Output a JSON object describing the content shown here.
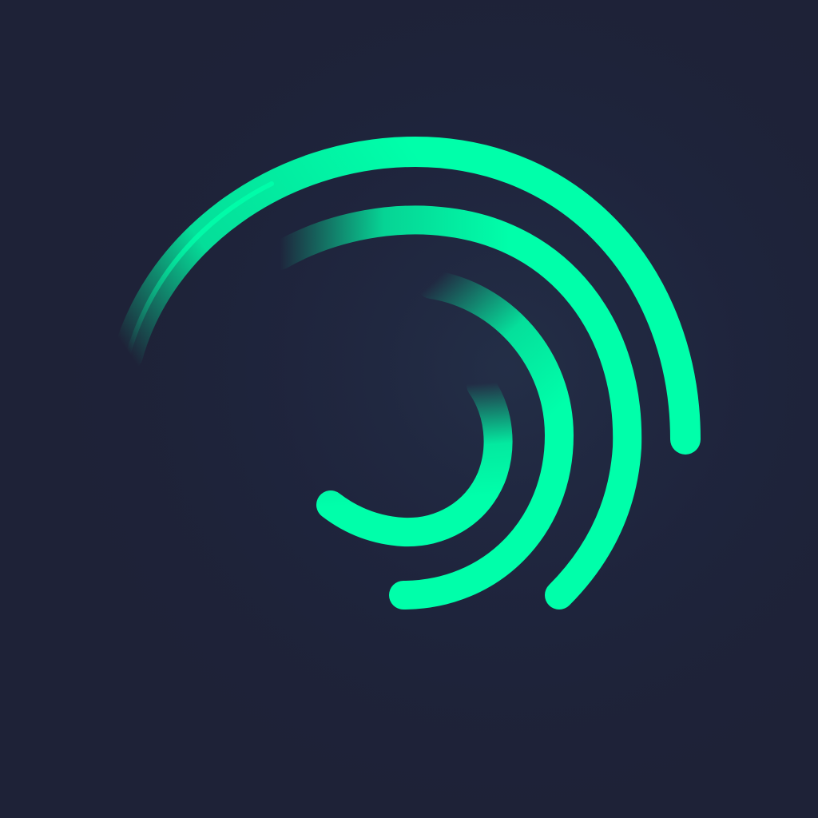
{
  "icon": {
    "name": "spiral-arcs-logo-icon",
    "colors": {
      "background": "#1e2237",
      "background_glow": "#22304a",
      "accent": "#00ffaa"
    }
  }
}
